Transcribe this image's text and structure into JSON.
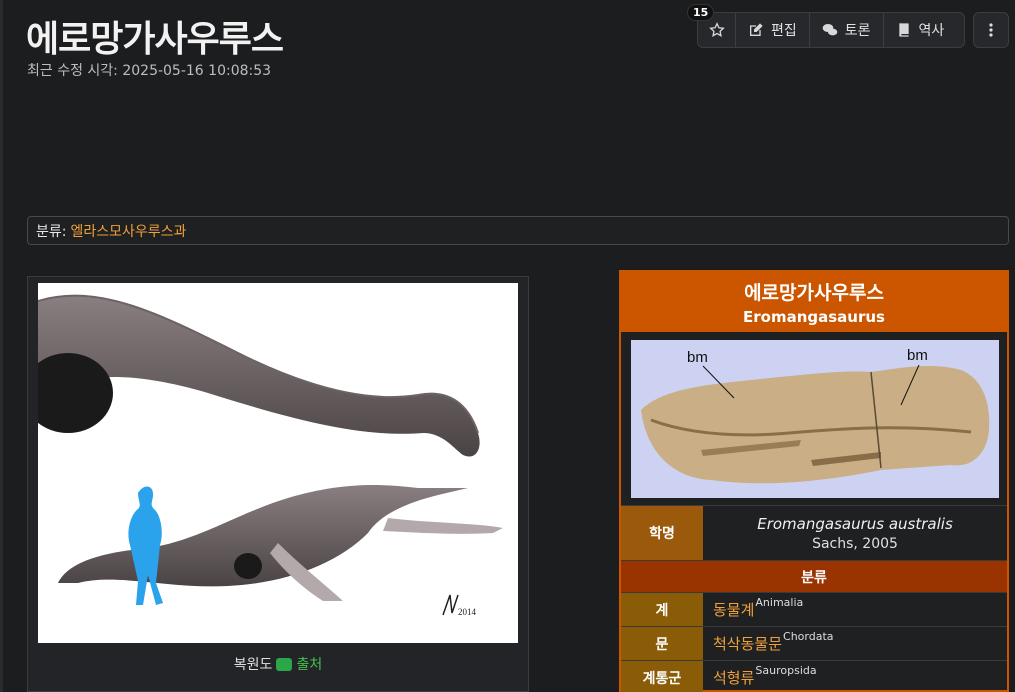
{
  "page": {
    "title": "에로망가사우루스",
    "modified": "최근 수정 시각: 2025-05-16 10:08:53"
  },
  "toolbar": {
    "star_count": "15",
    "edit_label": "편집",
    "discuss_label": "토론",
    "history_label": "역사"
  },
  "category": {
    "label": "분류:",
    "link": "엘라스모사우루스과"
  },
  "figure": {
    "caption": "복원도",
    "source_label": "출처",
    "signature": "2014"
  },
  "infobox": {
    "title_kor": "에로망가사우루스",
    "title_lat": "Eromangasaurus",
    "photo_label_left": "bm",
    "photo_label_right": "bm",
    "sci_label": "학명",
    "sci_name": "Eromangasaurus australis",
    "sci_author": "Sachs, 2005",
    "class_header": "분류",
    "taxa": [
      {
        "rank": "계",
        "kor": "동물계",
        "lat": "Animalia"
      },
      {
        "rank": "문",
        "kor": "척삭동물문",
        "lat": "Chordata"
      },
      {
        "rank": "계통군",
        "kor": "석형류",
        "lat": "Sauropsida"
      }
    ]
  },
  "colors": {
    "accent": "#cc5500",
    "link": "#f0a13a",
    "source": "#44c24d"
  }
}
